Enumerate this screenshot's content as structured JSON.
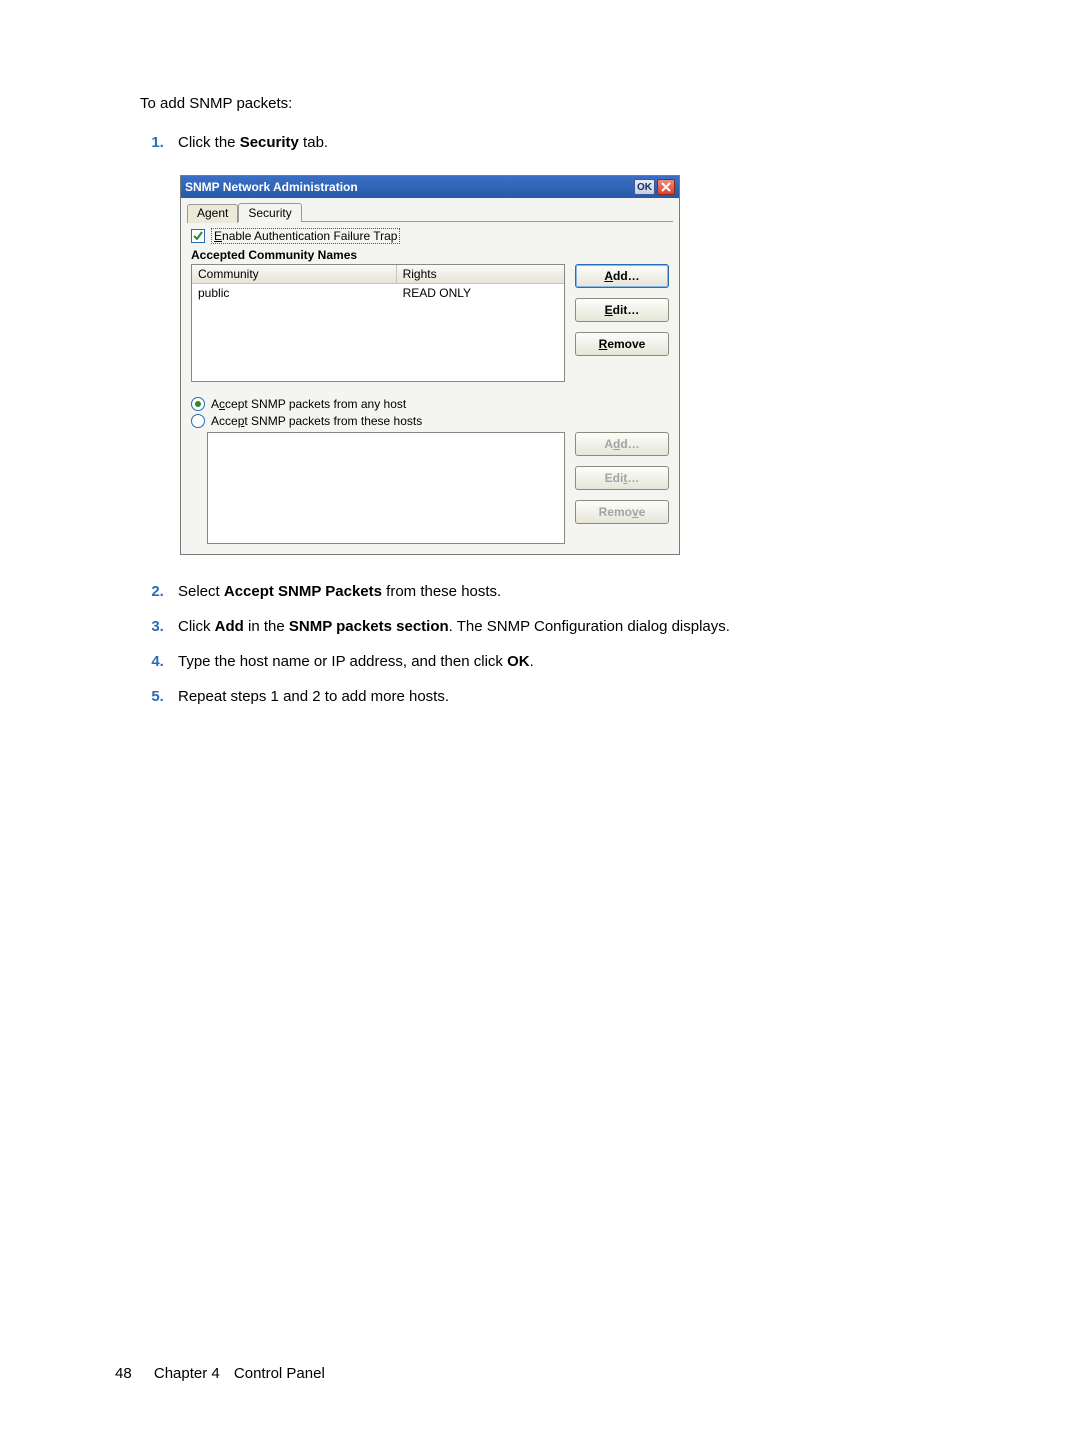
{
  "intro": "To add SNMP packets:",
  "steps_top": [
    {
      "pre": "Click the ",
      "bold": "Security",
      "post": " tab."
    }
  ],
  "dialog": {
    "title": "SNMP Network Administration",
    "ok_label": "OK",
    "tabs": {
      "agent": "Agent",
      "security": "Security"
    },
    "enable_trap": "Enable Authentication Failure Trap",
    "accepted_title": "Accepted Community Names",
    "col_community": "Community",
    "col_rights": "Rights",
    "row_community": "public",
    "row_rights": "READ ONLY",
    "btn_add": "Add…",
    "btn_edit": "Edit…",
    "btn_remove": "Remove",
    "radio_any": "Accept SNMP packets from any host",
    "radio_these": "Accept SNMP packets from these hosts",
    "btn_add2": "Add…",
    "btn_edit2": "Edit…",
    "btn_remove2": "Remove"
  },
  "steps_bottom": [
    {
      "num": "2.",
      "parts": [
        "Select ",
        "Accept SNMP Packets",
        " from these hosts."
      ]
    },
    {
      "num": "3.",
      "parts": [
        "Click ",
        "Add",
        " in the ",
        "SNMP packets section",
        ". The SNMP Configuration dialog displays."
      ]
    },
    {
      "num": "4.",
      "parts": [
        "Type the host name or IP address, and then click ",
        "OK",
        "."
      ]
    },
    {
      "num": "5.",
      "parts": [
        "Repeat steps 1 and 2 to add more hosts."
      ]
    }
  ],
  "footer": {
    "page_number": "48",
    "chapter": "Chapter 4",
    "chapter_title": "Control Panel"
  }
}
